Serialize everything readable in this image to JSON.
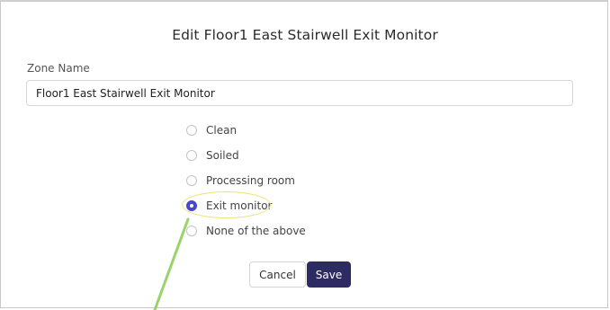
{
  "modal": {
    "title": "Edit Floor1 East Stairwell Exit Monitor",
    "zone_name_label": "Zone Name",
    "zone_name_value": "Floor1 East Stairwell Exit Monitor"
  },
  "zone_types": {
    "options": [
      "Clean",
      "Soiled",
      "Processing room",
      "Exit monitor",
      "None of the above"
    ],
    "selected": "Exit monitor"
  },
  "buttons": {
    "cancel": "Cancel",
    "save": "Save"
  },
  "colors": {
    "accent": "#4a47c9",
    "save_button": "#2e2a63",
    "highlight": "#ece27a",
    "annotation_arrow": "#9ad36a"
  }
}
